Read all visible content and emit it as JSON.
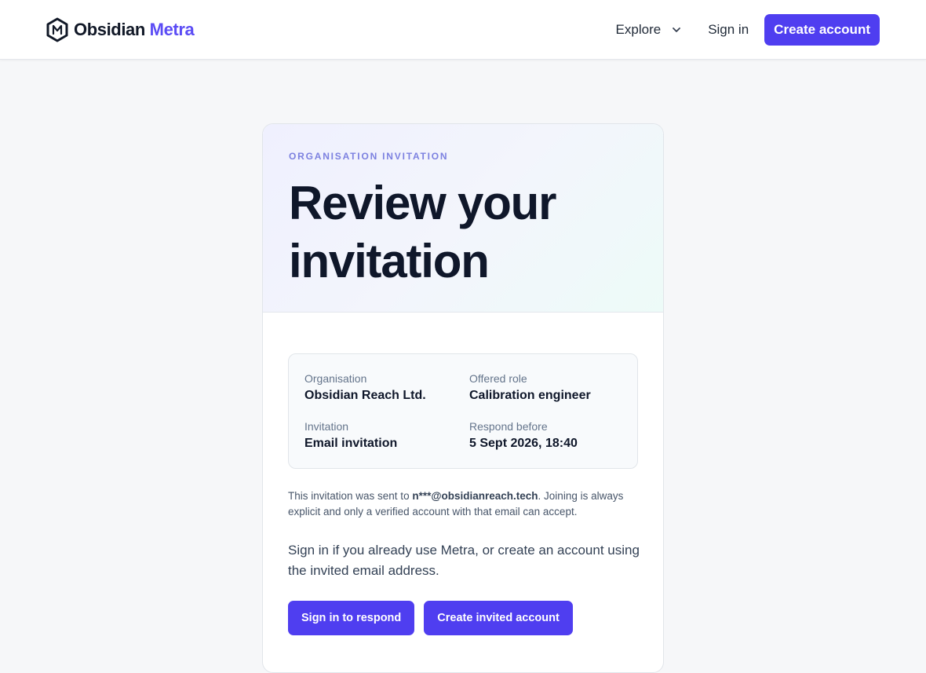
{
  "header": {
    "brand_name": "Obsidian",
    "brand_accent": "Metra",
    "nav": {
      "explore_label": "Explore",
      "signin_label": "Sign in",
      "create_account_label": "Create account"
    }
  },
  "card": {
    "eyebrow": "ORGANISATION INVITATION",
    "title": "Review your invitation",
    "details": {
      "organisation_label": "Organisation",
      "organisation_value": "Obsidian Reach Ltd.",
      "role_label": "Offered role",
      "role_value": "Calibration engineer",
      "invitation_label": "Invitation",
      "invitation_value": "Email invitation",
      "deadline_label": "Respond before",
      "deadline_value": "5 Sept 2026, 18:40"
    },
    "note": {
      "prefix": "This invitation was sent to ",
      "email": "n***@obsidianreach.tech",
      "suffix": ". Joining is always explicit and only a verified account with that email can accept."
    },
    "lead": "Sign in if you already use Metra, or create an account using the invited email address.",
    "actions": {
      "signin_label": "Sign in to respond",
      "create_label": "Create invited account"
    }
  },
  "colors": {
    "accent": "#4f3ef0",
    "brand_accent": "#5b4cf5",
    "eyebrow": "#7c81e0"
  },
  "icons": {
    "logo": "hexagon-m-logo-icon",
    "explore": "chevron-down-icon"
  }
}
